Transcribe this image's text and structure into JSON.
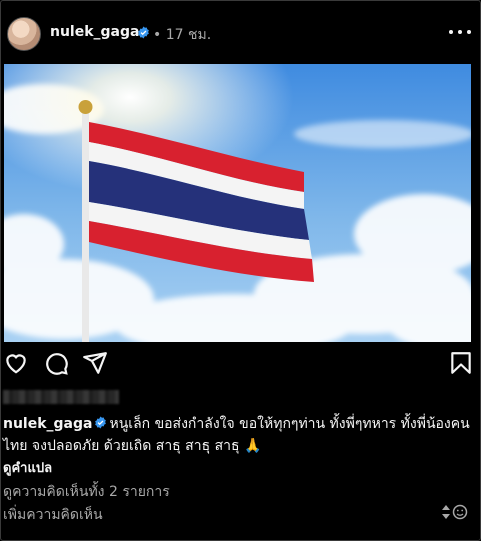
{
  "post": {
    "username": "nulek_gaga",
    "time_ago": "• 17 ชม.",
    "caption_username": "nulek_gaga",
    "caption_text": "หนูเล็ก ขอส่งกำลังใจ ขอให้ทุกๆท่าน ทั้งพี่ๆทหาร ทั้งพี่น้องคนไทย จงปลอดภัย ด้วยเถิด สาธุ สาธุ สาธุ 🙏",
    "translate_label": "ดูคำแปล",
    "view_comments": "ดูความคิดเห็นทั้ง 2 รายการ",
    "add_comment_placeholder": "เพิ่มความคิดเห็น"
  },
  "colors": {
    "verified": "#3897f0",
    "secondary_text": "#a8a8a8",
    "background": "#000000"
  },
  "icons": [
    "heart-icon",
    "comment-icon",
    "share-icon",
    "bookmark-icon",
    "more-icon",
    "emoji-icon",
    "verified-badge-icon"
  ]
}
